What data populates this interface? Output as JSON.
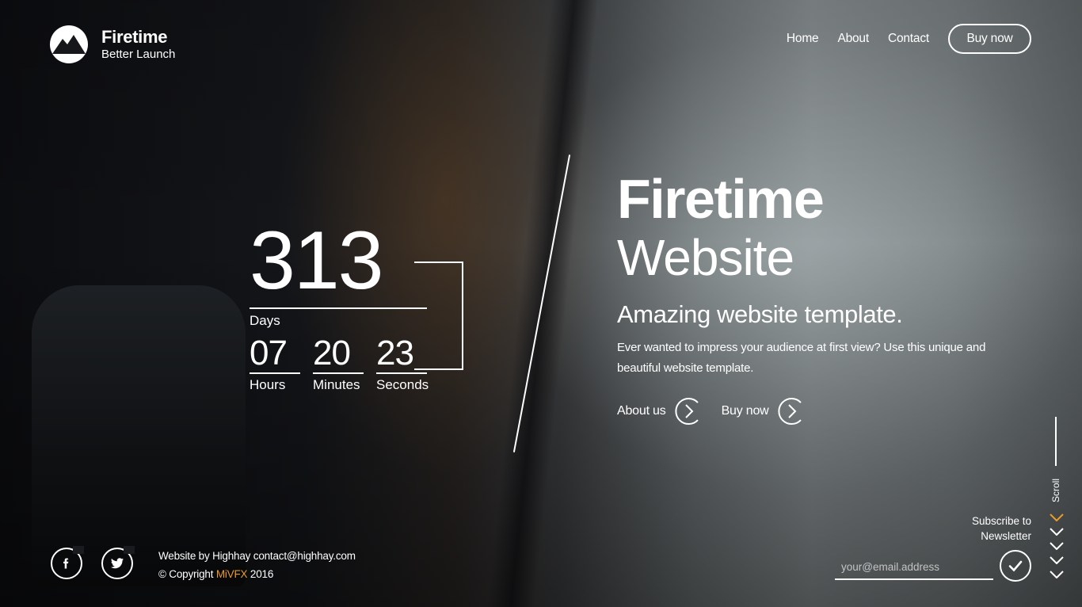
{
  "header": {
    "brand_name": "Firetime",
    "brand_tagline": "Better Launch",
    "nav": [
      {
        "label": "Home"
      },
      {
        "label": "About"
      },
      {
        "label": "Contact"
      }
    ],
    "buy_label": "Buy now"
  },
  "countdown": {
    "days": "313",
    "days_label": "Days",
    "hours": "07",
    "hours_label": "Hours",
    "minutes": "20",
    "minutes_label": "Minutes",
    "seconds": "23",
    "seconds_label": "Seconds"
  },
  "hero": {
    "title_bold": "Firetime",
    "title_light": "Website",
    "subtitle": "Amazing website template.",
    "description": "Ever wanted to impress your audience at first view? Use this unique and beautiful website template.",
    "cta_about": "About us",
    "cta_buy": "Buy now"
  },
  "scroll_label": "Scroll",
  "footer": {
    "credit_line": "Website by Highhay contact@highhay.com",
    "copyright_prefix": "© Copyright ",
    "copyright_brand": "MiVFX",
    "copyright_year": " 2016",
    "newsletter_label_1": "Subscribe to",
    "newsletter_label_2": "Newsletter",
    "email_placeholder": "your@email.address",
    "social": [
      "facebook-icon",
      "twitter-icon"
    ]
  },
  "colors": {
    "accent": "#e89a2c",
    "text": "#ffffff"
  }
}
